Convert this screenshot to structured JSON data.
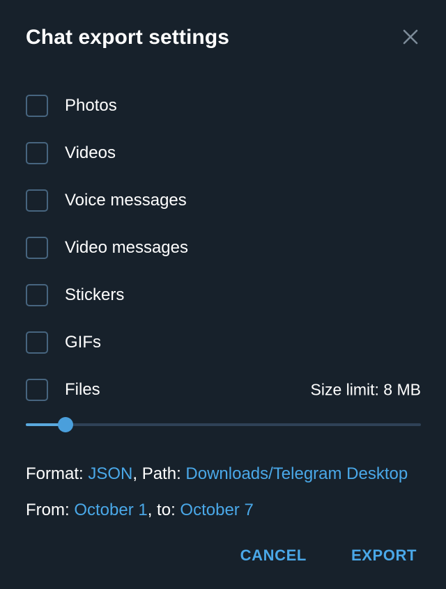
{
  "dialog": {
    "title": "Chat export settings",
    "close_icon": "close-icon"
  },
  "options": [
    {
      "label": "Photos",
      "checked": false
    },
    {
      "label": "Videos",
      "checked": false
    },
    {
      "label": "Voice messages",
      "checked": false
    },
    {
      "label": "Video messages",
      "checked": false
    },
    {
      "label": "Stickers",
      "checked": false
    },
    {
      "label": "GIFs",
      "checked": false
    },
    {
      "label": "Files",
      "checked": false
    }
  ],
  "size_limit": {
    "text": "Size limit: 8 MB",
    "value": 8,
    "unit": "MB",
    "slider_percent": 10
  },
  "info": {
    "format_prefix": "Format: ",
    "format_value": "JSON",
    "path_prefix": ", Path: ",
    "path_value": "Downloads/Telegram Desktop",
    "from_prefix": "From: ",
    "from_value": "October 1",
    "to_prefix": ", to: ",
    "to_value": "October 7"
  },
  "footer": {
    "cancel_label": "CANCEL",
    "export_label": "EXPORT"
  },
  "colors": {
    "background": "#17212b",
    "accent": "#4aa8e8",
    "checkbox_border": "#47657f",
    "slider_track": "#2f4257",
    "slider_fill": "#5aa9de",
    "text": "#ffffff",
    "close_icon": "#7c8b99"
  }
}
